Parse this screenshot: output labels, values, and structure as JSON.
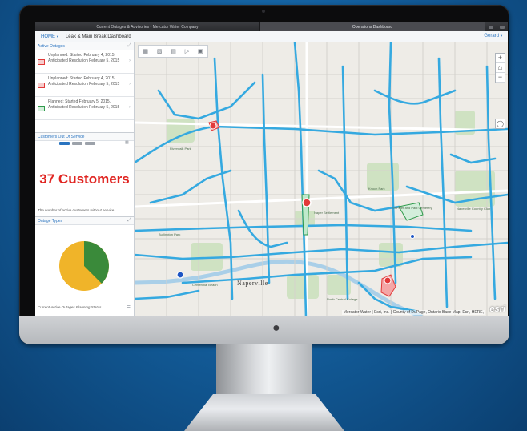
{
  "browser": {
    "tabs": [
      "Current Outages & Advisories - Mercator Water Company",
      "Operations Dashboard"
    ]
  },
  "header": {
    "home": "HOME",
    "title": "Leak & Main Break Dashboard",
    "user": "Gerard"
  },
  "active_outages": {
    "title": "Active Outages",
    "items": [
      {
        "type": "unplanned",
        "text": "Unplanned: Started February 4, 2015, Anticipated Resolution February 5, 2015"
      },
      {
        "type": "unplanned",
        "text": "Unplanned: Started February 4, 2015, Anticipated Resolution February 5, 2015"
      },
      {
        "type": "planned",
        "text": "Planned: Started February 5, 2015, Anticipated Resolution February 5, 2015"
      }
    ]
  },
  "customers": {
    "title": "Customers Out Of Service",
    "count": "37 Customers",
    "note": "The number of active customers without service"
  },
  "outage_types": {
    "title": "Outage Types",
    "caption": "Current Active Outages Planning Status...",
    "colors": {
      "unplanned": "#f0b429",
      "planned": "#3a8a3a"
    }
  },
  "map": {
    "attribution": "Mercator Water | Esri, Inc. | County of DuPage, Ontario Base Map, Esri, HERE,",
    "logo": "esri",
    "city": "Naperville",
    "labels": [
      "Riverwalk Park",
      "Burlington Park",
      "Centennial Beach",
      "Knoch Park",
      "Naper Settlement",
      "St Peter and Paul Cemetery",
      "Naperville Country Club",
      "North Central College"
    ],
    "line_color": "#35a9e0"
  },
  "colors": {
    "unplanned": "#e23a3a",
    "planned": "#2e9a4a",
    "accent": "#2a74c0",
    "customers": "#e02420"
  }
}
